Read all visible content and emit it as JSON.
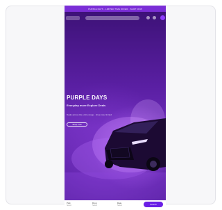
{
  "banner": {
    "text": "PURPLE DAYS · LIMITED TIME OFFER · SHOP NOW"
  },
  "hero": {
    "title": "PURPLE DAYS",
    "subtitle": "Everyday more Explore Deals",
    "description": "Deals across the entire range · shop now, limited",
    "cta_label": "Shop now"
  },
  "booking": {
    "field1_label": "Pick",
    "field1_value": "Select",
    "field2_label": "Drop",
    "field2_value": "Select",
    "field3_label": "Date",
    "field3_value": "Select",
    "submit_label": "Search"
  },
  "colors": {
    "accent": "#6a1fe6",
    "hero_bg": "#5a1fa3",
    "card_border": "#e3e3e8"
  }
}
